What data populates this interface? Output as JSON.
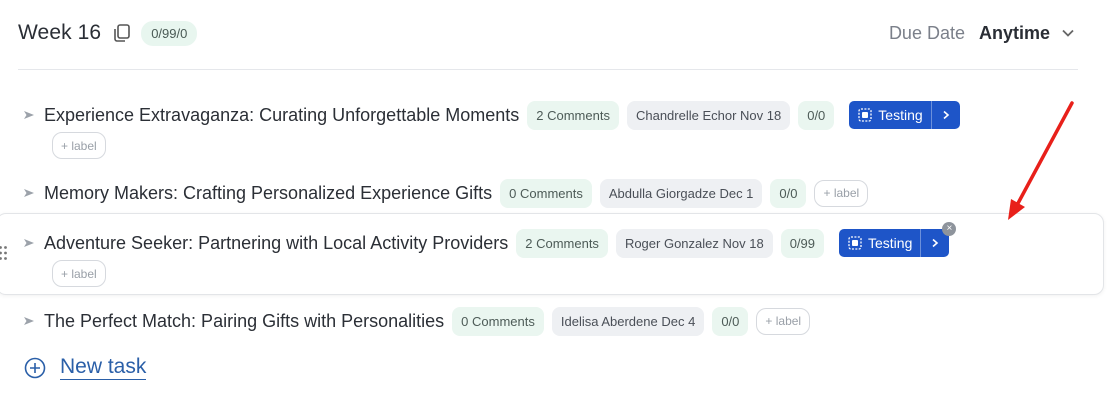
{
  "header": {
    "title": "Week 16",
    "count_badge": "0/99/0",
    "due_label": "Due Date",
    "due_value": "Anytime"
  },
  "tasks": [
    {
      "title": "Experience Extravaganza: Curating Unforgettable Moments",
      "comments": "2 Comments",
      "assignee": "Chandrelle Echor Nov 18",
      "ratio": "0/0",
      "status": "Testing",
      "label_button": "+ label"
    },
    {
      "title": "Memory Makers: Crafting Personalized Experience Gifts",
      "comments": "0 Comments",
      "assignee": "Abdulla Giorgadze Dec 1",
      "ratio": "0/0",
      "label_button": "+ label"
    },
    {
      "title": "Adventure Seeker: Partnering with Local Activity Providers",
      "comments": "2 Comments",
      "assignee": "Roger Gonzalez Nov 18",
      "ratio": "0/99",
      "status": "Testing",
      "label_button": "+ label"
    },
    {
      "title": "The Perfect Match: Pairing Gifts with Personalities",
      "comments": "0 Comments",
      "assignee": "Idelisa Aberdene Dec 4",
      "ratio": "0/0",
      "label_button": "+ label"
    }
  ],
  "new_task_label": "New task",
  "colors": {
    "status_blue": "#1e55c8",
    "comment_bg": "#eaf6f0",
    "assignee_bg": "#eef0f3",
    "link_blue": "#2a5fa8",
    "annotation_red": "#e8201a"
  }
}
